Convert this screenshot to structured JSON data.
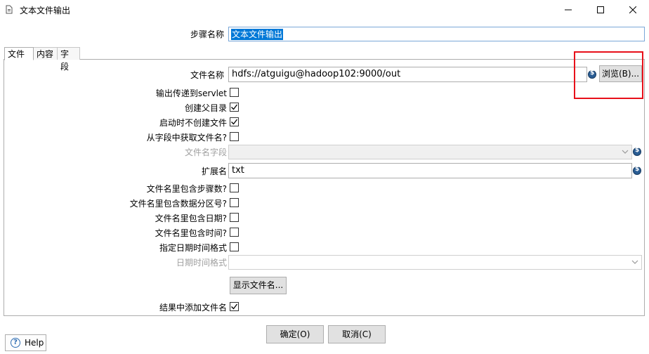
{
  "window": {
    "title": "文本文件输出",
    "controls": {
      "minimize": "minimize-icon",
      "maximize": "maximize-icon",
      "close": "close-icon"
    }
  },
  "step": {
    "label": "步骤名称",
    "value": "文本文件输出"
  },
  "tabs": [
    {
      "label": "文件",
      "active": true
    },
    {
      "label": "内容",
      "active": false
    },
    {
      "label": "字段",
      "active": false
    }
  ],
  "file": {
    "filename_label": "文件名称",
    "filename_value": "hdfs://atguigu@hadoop102:9000/out",
    "browse_label": "浏览(B)...",
    "servlet_label": "输出传递到servlet",
    "servlet_checked": false,
    "create_parent_label": "创建父目录",
    "create_parent_checked": true,
    "no_create_label": "启动时不创建文件",
    "no_create_checked": true,
    "from_field_label": "从字段中获取文件名?",
    "from_field_checked": false,
    "filename_field_label": "文件名字段",
    "filename_field_value": "",
    "extension_label": "扩展名",
    "extension_value": "txt",
    "step_nr_label": "文件名里包含步骤数?",
    "step_nr_checked": false,
    "partition_label": "文件名里包含数据分区号?",
    "partition_checked": false,
    "date_label": "文件名里包含日期?",
    "date_checked": false,
    "time_label": "文件名里包含时间?",
    "time_checked": false,
    "date_format_flag_label": "指定日期时间格式",
    "date_format_flag_checked": false,
    "date_format_label": "日期时间格式",
    "date_format_value": "",
    "show_files_label": "显示文件名...",
    "add_result_label": "结果中添加文件名",
    "add_result_checked": true
  },
  "buttons": {
    "ok": "确定(O)",
    "cancel": "取消(C)",
    "help": "Help"
  },
  "colors": {
    "highlight": "#0078d7",
    "annotation_box": "#e8101a",
    "variable_icon": "#2a5d94"
  }
}
